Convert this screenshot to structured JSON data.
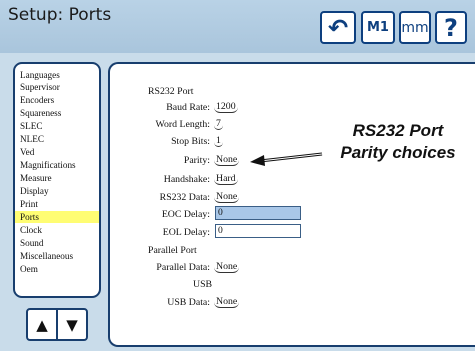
{
  "header": {
    "title": "Setup: Ports",
    "buttons": {
      "undo": "↶",
      "m1": "M1",
      "mm": "mm",
      "help": "?"
    }
  },
  "sidebar": {
    "items": [
      {
        "label": "Languages"
      },
      {
        "label": "Supervisor"
      },
      {
        "label": "Encoders"
      },
      {
        "label": "Squareness"
      },
      {
        "label": "SLEC"
      },
      {
        "label": "NLEC"
      },
      {
        "label": "Ved"
      },
      {
        "label": "Magnifications"
      },
      {
        "label": "Measure"
      },
      {
        "label": "Display"
      },
      {
        "label": "Print"
      },
      {
        "label": "Ports",
        "active": true
      },
      {
        "label": "Clock"
      },
      {
        "label": "Sound"
      },
      {
        "label": "Miscellaneous"
      },
      {
        "label": "Oem"
      }
    ],
    "up_arrow": "▲",
    "down_arrow": "▼"
  },
  "settings": {
    "rs232_heading": "RS232 Port",
    "baud_rate_label": "Baud Rate:",
    "baud_rate_value": "1200",
    "word_length_label": "Word Length:",
    "word_length_value": "7",
    "stop_bits_label": "Stop Bits:",
    "stop_bits_value": "1",
    "parity_label": "Parity:",
    "parity_value": "None",
    "handshake_label": "Handshake:",
    "handshake_value": "Hard",
    "rs232_data_label": "RS232 Data:",
    "rs232_data_value": "None",
    "eoc_delay_label": "EOC Delay:",
    "eoc_delay_value": "0",
    "eol_delay_label": "EOL Delay:",
    "eol_delay_value": "0",
    "parallel_heading": "Parallel Port",
    "parallel_data_label": "Parallel Data:",
    "parallel_data_value": "None",
    "usb_heading": "USB",
    "usb_data_label": "USB Data:",
    "usb_data_value": "None"
  },
  "callout": {
    "line1": "RS232 Port",
    "line2": "Parity choices"
  }
}
